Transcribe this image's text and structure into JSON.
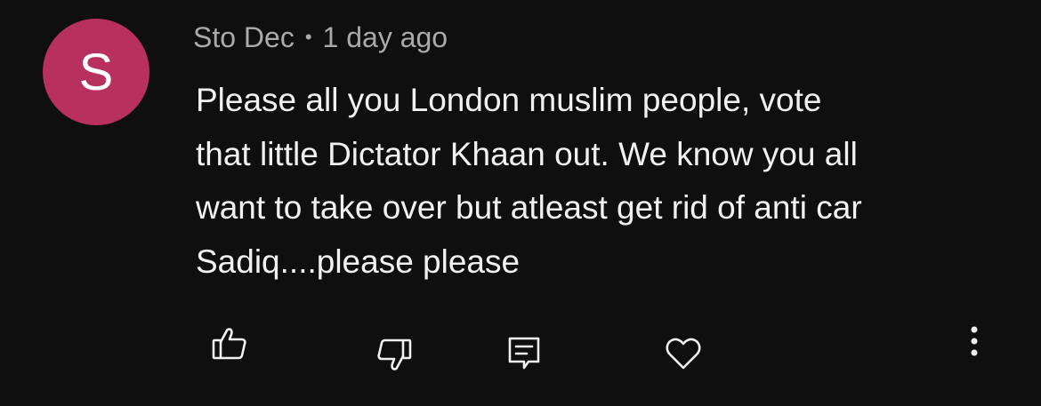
{
  "comment": {
    "avatar_letter": "S",
    "avatar_color": "#b8305e",
    "author": "Sto Dec",
    "separator": "•",
    "timestamp": "1 day ago",
    "text_lines": [
      "Please all you London muslim people, vote",
      "that little Dictator Khaan out. We know you all",
      "want to take over but atleast get rid of anti car",
      "Sadiq....please please"
    ]
  },
  "actions": {
    "like_icon": "thumbs-up-icon",
    "dislike_icon": "thumbs-down-icon",
    "reply_icon": "reply-icon",
    "heart_icon": "heart-icon",
    "more_icon": "more-vert-icon"
  }
}
